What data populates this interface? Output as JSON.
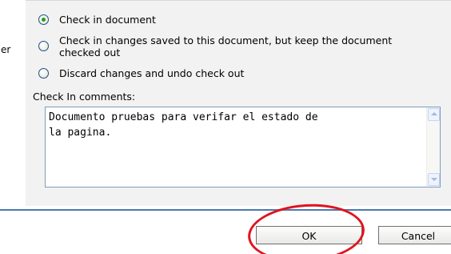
{
  "left": {
    "label": "er"
  },
  "options": [
    {
      "text": "Check in document",
      "selected": true
    },
    {
      "text": "Check in changes saved to this document, but keep the document\nchecked out",
      "selected": false
    },
    {
      "text": "Discard changes and undo check out",
      "selected": false
    }
  ],
  "comments": {
    "label": "Check In comments:",
    "value": "Documento pruebas para verifar el estado de\nla pagina."
  },
  "buttons": {
    "ok_label": "OK",
    "cancel_label": "Cancel"
  },
  "colors": {
    "panel_bg": "#f2f2f2",
    "radio_selected": "#21a121",
    "separator": "#4a7ab0",
    "annotation": "#e0141e"
  },
  "annotation": {
    "shape": "red ellipse",
    "target": "OK button"
  }
}
